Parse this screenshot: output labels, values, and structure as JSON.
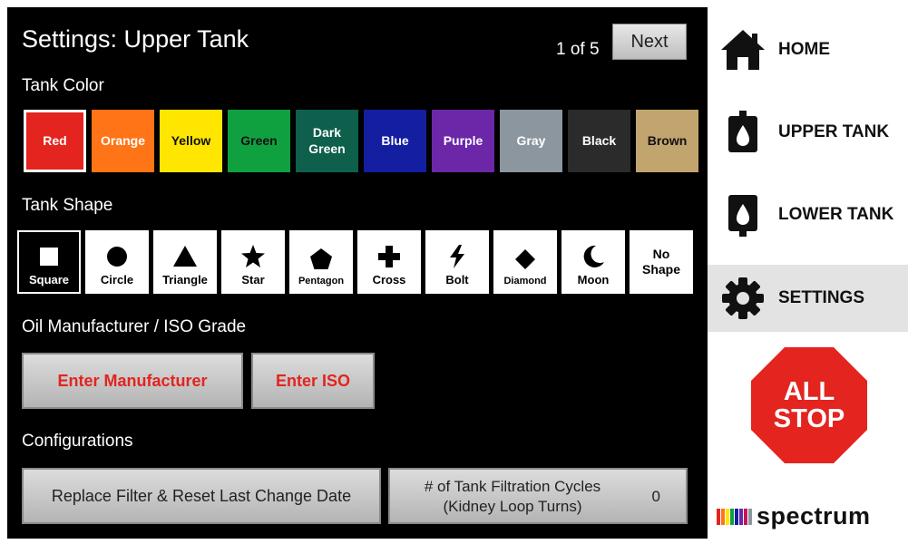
{
  "header": {
    "title": "Settings: Upper Tank",
    "pager": "1 of 5",
    "next_label": "Next"
  },
  "tank_color": {
    "heading": "Tank Color",
    "selected": "Red",
    "swatches": [
      {
        "label": "Red",
        "color": "#e3241f",
        "text_color": "#ffffff"
      },
      {
        "label": "Orange",
        "color": "#ff7417",
        "text_color": "#ffffff"
      },
      {
        "label": "Yellow",
        "color": "#ffe600",
        "text_color": "#111111"
      },
      {
        "label": "Green",
        "color": "#0fa040",
        "text_color": "#111111"
      },
      {
        "label": "Dark\nGreen",
        "color": "#0e5f4b",
        "text_color": "#ffffff"
      },
      {
        "label": "Blue",
        "color": "#141ea0",
        "text_color": "#ffffff"
      },
      {
        "label": "Purple",
        "color": "#6b27a8",
        "text_color": "#ffffff"
      },
      {
        "label": "Gray",
        "color": "#8c969e",
        "text_color": "#ffffff"
      },
      {
        "label": "Black",
        "color": "#2b2b2b",
        "text_color": "#ffffff"
      },
      {
        "label": "Brown",
        "color": "#c2a46f",
        "text_color": "#111111"
      }
    ]
  },
  "tank_shape": {
    "heading": "Tank Shape",
    "selected": "Square",
    "shapes": [
      {
        "label": "Square",
        "icon": "square-icon"
      },
      {
        "label": "Circle",
        "icon": "circle-icon"
      },
      {
        "label": "Triangle",
        "icon": "triangle-icon"
      },
      {
        "label": "Star",
        "icon": "star-icon"
      },
      {
        "label": "Pentagon",
        "icon": "pentagon-icon"
      },
      {
        "label": "Cross",
        "icon": "cross-icon"
      },
      {
        "label": "Bolt",
        "icon": "bolt-icon"
      },
      {
        "label": "Diamond",
        "icon": "diamond-icon"
      },
      {
        "label": "Moon",
        "icon": "moon-icon"
      },
      {
        "label": "No\nShape",
        "icon": ""
      }
    ]
  },
  "oil": {
    "heading": "Oil Manufacturer / ISO Grade",
    "manufacturer_label": "Enter Manufacturer",
    "iso_label": "Enter ISO"
  },
  "config": {
    "heading": "Configurations",
    "replace_filter_label": "Replace Filter & Reset Last Change Date",
    "cycles_label": "# of Tank Filtration Cycles\n(Kidney Loop Turns)",
    "cycles_value": "0"
  },
  "sidebar": {
    "items": [
      {
        "label": "HOME",
        "icon": "home-icon",
        "active": false
      },
      {
        "label": "UPPER TANK",
        "icon": "upper-tank-icon",
        "active": false
      },
      {
        "label": "LOWER TANK",
        "icon": "lower-tank-icon",
        "active": false
      },
      {
        "label": "SETTINGS",
        "icon": "gear-icon",
        "active": true
      }
    ],
    "all_stop": {
      "line1": "ALL",
      "line2": "STOP",
      "color": "#e3241f"
    },
    "logo": {
      "text": "spectrum",
      "bar_colors": [
        "#e3241f",
        "#ff7417",
        "#ffe600",
        "#0fa040",
        "#141ea0",
        "#6b27a8",
        "#c2185b",
        "#8c969e"
      ]
    }
  }
}
